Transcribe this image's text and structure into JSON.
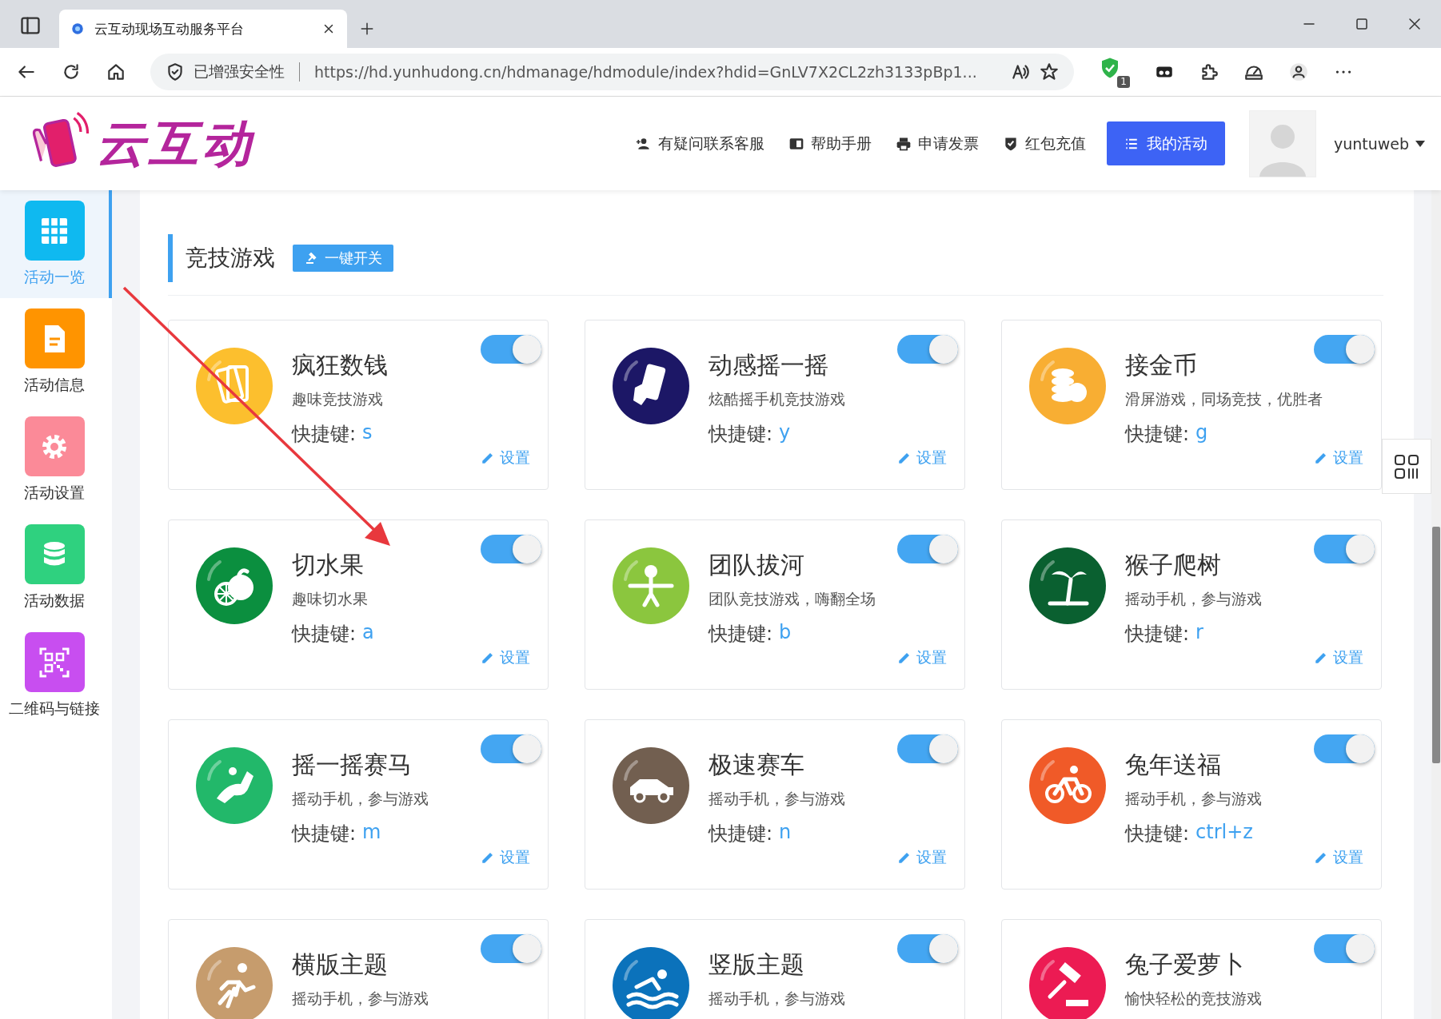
{
  "browser": {
    "tab": {
      "title": "云互动现场互动服务平台"
    },
    "address": {
      "security_label": "已增强安全性",
      "url": "https://hd.yunhudong.cn/hdmanage/hdmodule/index?hdid=GnLV7X2CL2zh3133pBp1..."
    },
    "extension_badge": "1"
  },
  "header": {
    "logo_text": "云互动",
    "links": [
      {
        "label": "有疑问联系客服",
        "kind": "contact"
      },
      {
        "label": "帮助手册",
        "kind": "help"
      },
      {
        "label": "申请发票",
        "kind": "invoice"
      },
      {
        "label": "红包充值",
        "kind": "recharge"
      }
    ],
    "primary_button": "我的活动",
    "user": "yuntuweb"
  },
  "sidebar": {
    "items": [
      {
        "label": "活动一览",
        "kind": "overview",
        "color": "#0fb9f0",
        "selected": true
      },
      {
        "label": "活动信息",
        "kind": "info",
        "color": "#ff9400",
        "selected": false
      },
      {
        "label": "活动设置",
        "kind": "settings",
        "color": "#fb8a98",
        "selected": false
      },
      {
        "label": "活动数据",
        "kind": "data",
        "color": "#2fd17f",
        "selected": false
      },
      {
        "label": "二维码与链接",
        "kind": "qrcode",
        "color": "#c84ef0",
        "selected": false
      }
    ]
  },
  "section": {
    "title": "竞技游戏",
    "toggle_all_button": "一键开关"
  },
  "games": [
    {
      "name": "疯狂数钱",
      "description": "趣味竞技游戏",
      "hotkey_label": "快捷键:",
      "hotkey": "s",
      "settings": "设置",
      "on": true,
      "kind": "cards",
      "color": "#fcbf2e"
    },
    {
      "name": "动感摇一摇",
      "description": "炫酷摇手机竞技游戏",
      "hotkey_label": "快捷键:",
      "hotkey": "y",
      "settings": "设置",
      "on": true,
      "kind": "phone",
      "color": "#1c1766"
    },
    {
      "name": "接金币",
      "description": "滑屏游戏，同场竞技，优胜者",
      "hotkey_label": "快捷键:",
      "hotkey": "g",
      "settings": "设置",
      "on": true,
      "kind": "coins",
      "color": "#f8ae33"
    },
    {
      "name": "切水果",
      "description": "趣味切水果",
      "hotkey_label": "快捷键:",
      "hotkey": "a",
      "settings": "设置",
      "on": true,
      "kind": "fruit",
      "color": "#0b8f3f"
    },
    {
      "name": "团队拔河",
      "description": "团队竞技游戏，嗨翻全场",
      "hotkey_label": "快捷键:",
      "hotkey": "b",
      "settings": "设置",
      "on": true,
      "kind": "person",
      "color": "#8bc63e"
    },
    {
      "name": "猴子爬树",
      "description": "摇动手机，参与游戏",
      "hotkey_label": "快捷键:",
      "hotkey": "r",
      "settings": "设置",
      "on": true,
      "kind": "palm",
      "color": "#0a6030"
    },
    {
      "name": "摇一摇赛马",
      "description": "摇动手机，参与游戏",
      "hotkey_label": "快捷键:",
      "hotkey": "m",
      "settings": "设置",
      "on": true,
      "kind": "horse",
      "color": "#22b86a"
    },
    {
      "name": "极速赛车",
      "description": "摇动手机，参与游戏",
      "hotkey_label": "快捷键:",
      "hotkey": "n",
      "settings": "设置",
      "on": true,
      "kind": "car",
      "color": "#725f50"
    },
    {
      "name": "兔年送福",
      "description": "摇动手机，参与游戏",
      "hotkey_label": "快捷键:",
      "hotkey": "ctrl+z",
      "settings": "设置",
      "on": true,
      "kind": "bike",
      "color": "#f05a28"
    },
    {
      "name": "横版主题",
      "description": "摇动手机，参与游戏",
      "on": true,
      "kind": "runner",
      "color": "#c69c6d"
    },
    {
      "name": "竖版主题",
      "description": "摇动手机，参与游戏",
      "on": true,
      "kind": "swimmer",
      "color": "#0b72bb"
    },
    {
      "name": "兔子爱萝卜",
      "description": "愉快轻松的竞技游戏",
      "on": true,
      "kind": "gavel",
      "color": "#ec1b53"
    }
  ]
}
